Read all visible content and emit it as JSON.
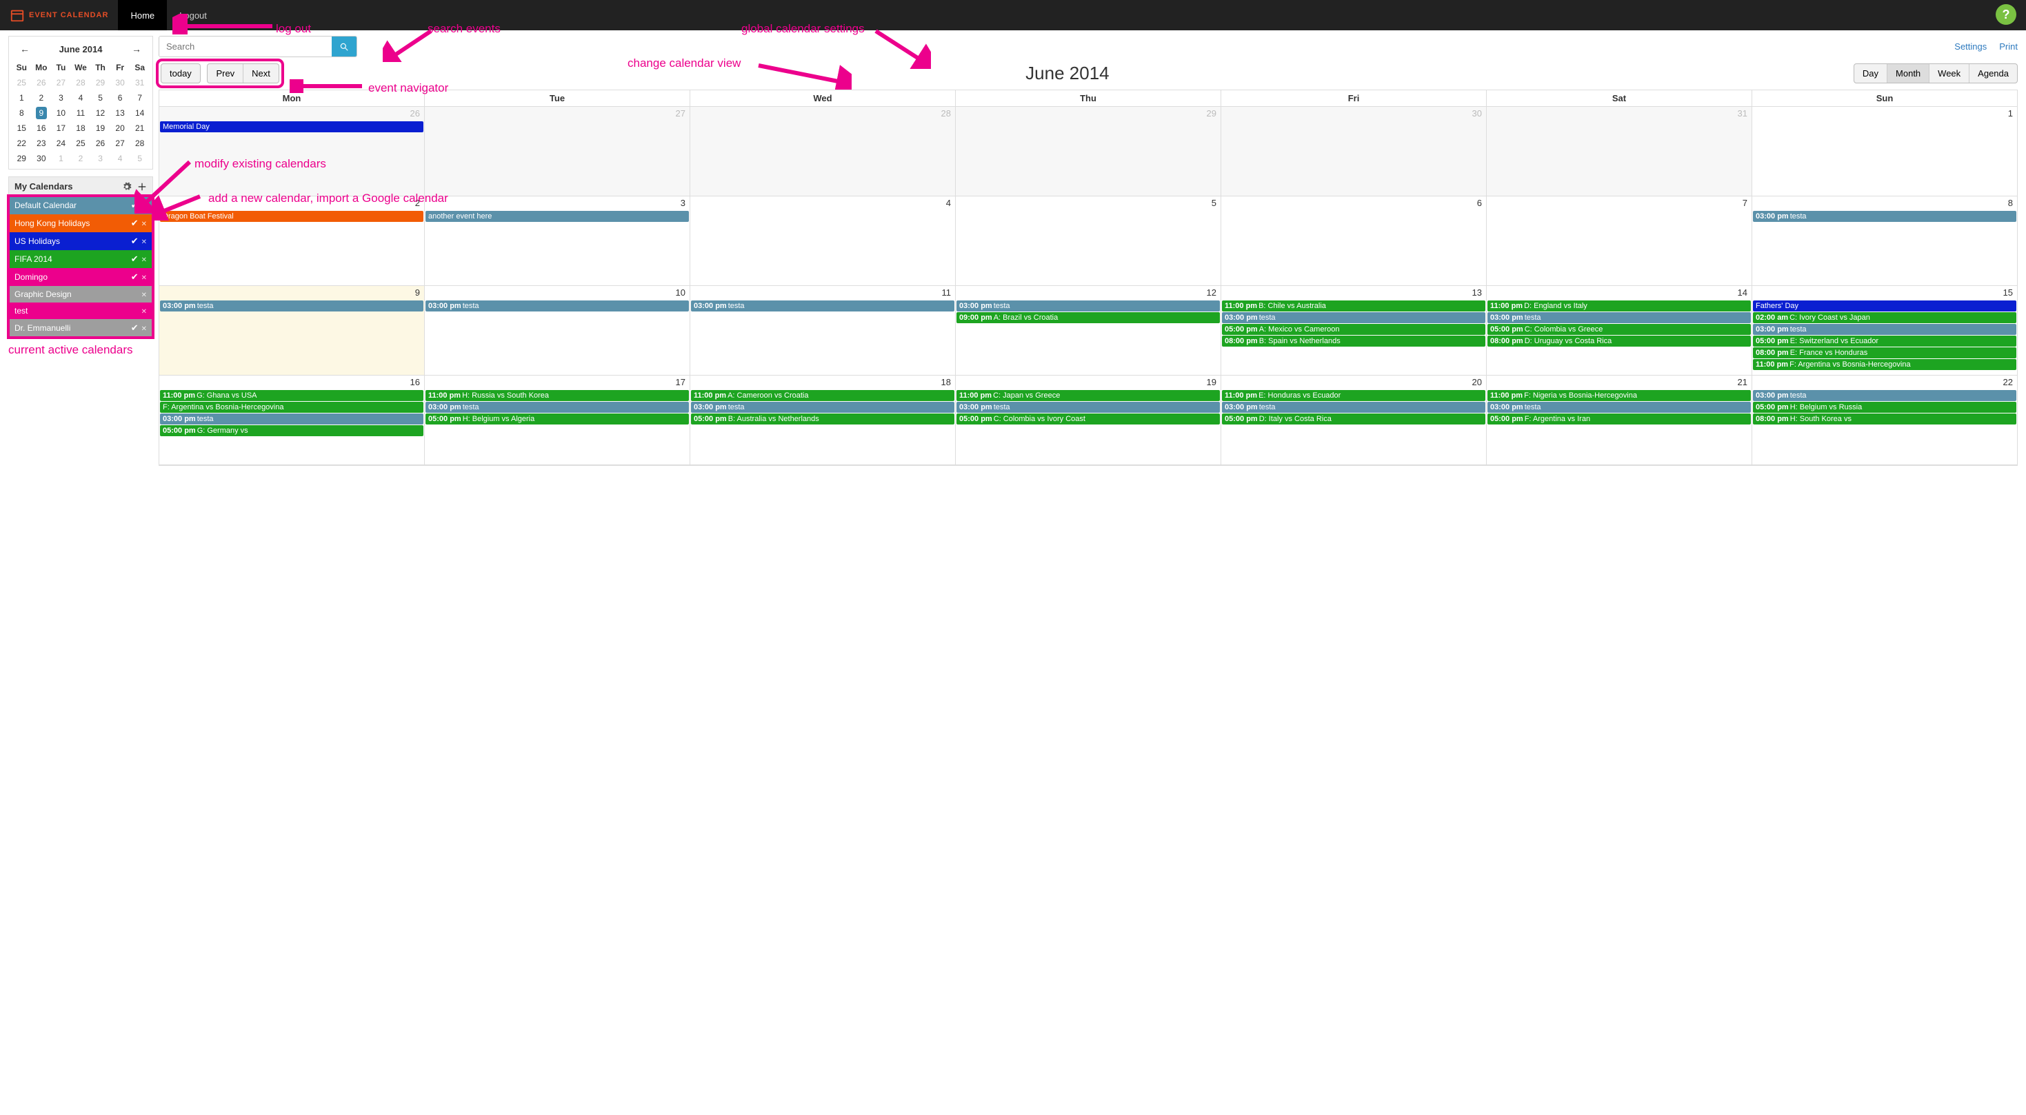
{
  "nav": {
    "logo": "EVENT CALENDAR",
    "home": "Home",
    "logout": "Logout"
  },
  "links": {
    "settings": "Settings",
    "print": "Print"
  },
  "search": {
    "placeholder": "Search"
  },
  "navbtn": {
    "today": "today",
    "prev": "Prev",
    "next": "Next"
  },
  "title": "June 2014",
  "views": {
    "day": "Day",
    "month": "Month",
    "week": "Week",
    "agenda": "Agenda"
  },
  "dow": [
    "Mon",
    "Tue",
    "Wed",
    "Thu",
    "Fri",
    "Sat",
    "Sun"
  ],
  "mini": {
    "title": "June 2014",
    "dow": [
      "Su",
      "Mo",
      "Tu",
      "We",
      "Th",
      "Fr",
      "Sa"
    ],
    "rows": [
      [
        {
          "n": 25,
          "dim": true
        },
        {
          "n": 26,
          "dim": true
        },
        {
          "n": 27,
          "dim": true
        },
        {
          "n": 28,
          "dim": true
        },
        {
          "n": 29,
          "dim": true
        },
        {
          "n": 30,
          "dim": true
        },
        {
          "n": 31,
          "dim": true
        }
      ],
      [
        {
          "n": 1
        },
        {
          "n": 2
        },
        {
          "n": 3
        },
        {
          "n": 4
        },
        {
          "n": 5
        },
        {
          "n": 6
        },
        {
          "n": 7
        }
      ],
      [
        {
          "n": 8
        },
        {
          "n": 9,
          "today": true
        },
        {
          "n": 10
        },
        {
          "n": 11
        },
        {
          "n": 12
        },
        {
          "n": 13
        },
        {
          "n": 14
        }
      ],
      [
        {
          "n": 15
        },
        {
          "n": 16
        },
        {
          "n": 17
        },
        {
          "n": 18
        },
        {
          "n": 19
        },
        {
          "n": 20
        },
        {
          "n": 21
        }
      ],
      [
        {
          "n": 22
        },
        {
          "n": 23
        },
        {
          "n": 24
        },
        {
          "n": 25
        },
        {
          "n": 26
        },
        {
          "n": 27
        },
        {
          "n": 28
        }
      ],
      [
        {
          "n": 29
        },
        {
          "n": 30
        },
        {
          "n": 1,
          "dim": true
        },
        {
          "n": 2,
          "dim": true
        },
        {
          "n": 3,
          "dim": true
        },
        {
          "n": 4,
          "dim": true
        },
        {
          "n": 5,
          "dim": true
        }
      ]
    ]
  },
  "mycalTitle": "My Calendars",
  "calendars": [
    {
      "name": "Default Calendar",
      "color": "#5b91aa",
      "checked": true
    },
    {
      "name": "Hong Kong Holidays",
      "color": "#f25c05",
      "checked": true
    },
    {
      "name": "US Holidays",
      "color": "#0a1fd1",
      "checked": true
    },
    {
      "name": "FIFA 2014",
      "color": "#1da421",
      "checked": true
    },
    {
      "name": "Domingo",
      "color": "#ec008c",
      "checked": true
    },
    {
      "name": "Graphic Design",
      "color": "#9e9e9e",
      "checked": false
    },
    {
      "name": "test",
      "color": "#ec008c",
      "checked": false
    },
    {
      "name": "Dr. Emmanuelli",
      "color": "#9e9e9e",
      "checked": true
    }
  ],
  "colors": {
    "blue": "#0a1fd1",
    "orange": "#f25c05",
    "teal": "#5b91aa",
    "green": "#1da421"
  },
  "weeks": [
    [
      {
        "n": 26,
        "other": true,
        "ev": [
          {
            "c": "blue",
            "txt": "Memorial Day"
          }
        ]
      },
      {
        "n": 27,
        "other": true
      },
      {
        "n": 28,
        "other": true
      },
      {
        "n": 29,
        "other": true
      },
      {
        "n": 30,
        "other": true
      },
      {
        "n": 31,
        "other": true
      },
      {
        "n": 1
      }
    ],
    [
      {
        "n": 2,
        "ev": [
          {
            "c": "orange",
            "txt": "Dragon Boat Festival"
          }
        ]
      },
      {
        "n": 3,
        "ev": [
          {
            "c": "teal",
            "txt": "another event here"
          }
        ]
      },
      {
        "n": 4
      },
      {
        "n": 5
      },
      {
        "n": 6
      },
      {
        "n": 7
      },
      {
        "n": 8,
        "ev": [
          {
            "c": "teal",
            "t": "03:00 pm",
            "txt": "testa"
          }
        ]
      }
    ],
    [
      {
        "n": 9,
        "today": true,
        "ev": [
          {
            "c": "teal",
            "t": "03:00 pm",
            "txt": "testa"
          }
        ]
      },
      {
        "n": 10,
        "ev": [
          {
            "c": "teal",
            "t": "03:00 pm",
            "txt": "testa"
          }
        ]
      },
      {
        "n": 11,
        "ev": [
          {
            "c": "teal",
            "t": "03:00 pm",
            "txt": "testa"
          }
        ]
      },
      {
        "n": 12,
        "ev": [
          {
            "c": "teal",
            "t": "03:00 pm",
            "txt": "testa"
          },
          {
            "c": "green",
            "t": "09:00 pm",
            "txt": "A: Brazil vs Croatia"
          }
        ]
      },
      {
        "n": 13,
        "ev": [
          {
            "c": "green",
            "t": "11:00 pm",
            "txt": "B: Chile vs Australia"
          },
          {
            "c": "teal",
            "t": "03:00 pm",
            "txt": "testa"
          },
          {
            "c": "green",
            "t": "05:00 pm",
            "txt": "A: Mexico vs Cameroon"
          },
          {
            "c": "green",
            "t": "08:00 pm",
            "txt": "B: Spain vs Netherlands"
          }
        ]
      },
      {
        "n": 14,
        "ev": [
          {
            "c": "green",
            "t": "11:00 pm",
            "txt": "D: England vs Italy"
          },
          {
            "c": "teal",
            "t": "03:00 pm",
            "txt": "testa"
          },
          {
            "c": "green",
            "t": "05:00 pm",
            "txt": "C: Colombia vs Greece"
          },
          {
            "c": "green",
            "t": "08:00 pm",
            "txt": "D: Uruguay vs Costa Rica"
          }
        ]
      },
      {
        "n": 15,
        "ev": [
          {
            "c": "blue",
            "txt": "Fathers' Day"
          },
          {
            "c": "green",
            "t": "02:00 am",
            "txt": "C: Ivory Coast vs Japan"
          },
          {
            "c": "teal",
            "t": "03:00 pm",
            "txt": "testa"
          },
          {
            "c": "green",
            "t": "05:00 pm",
            "txt": "E: Switzerland vs Ecuador"
          },
          {
            "c": "green",
            "t": "08:00 pm",
            "txt": "E: France vs Honduras"
          },
          {
            "c": "green",
            "t": "11:00 pm",
            "txt": "F: Argentina vs Bosnia-Hercegovina"
          }
        ]
      }
    ],
    [
      {
        "n": 16,
        "ev": [
          {
            "c": "green",
            "t": "11:00 pm",
            "txt": "G: Ghana vs USA"
          },
          {
            "c": "green",
            "txt": "F: Argentina vs Bosnia-Hercegovina"
          },
          {
            "c": "teal",
            "t": "03:00 pm",
            "txt": "testa"
          },
          {
            "c": "green",
            "t": "05:00 pm",
            "txt": "G: Germany vs"
          }
        ]
      },
      {
        "n": 17,
        "ev": [
          {
            "c": "green",
            "t": "11:00 pm",
            "txt": "H: Russia vs South Korea"
          },
          {
            "c": "teal",
            "t": "03:00 pm",
            "txt": "testa"
          },
          {
            "c": "green",
            "t": "05:00 pm",
            "txt": "H: Belgium vs Algeria"
          }
        ]
      },
      {
        "n": 18,
        "ev": [
          {
            "c": "green",
            "t": "11:00 pm",
            "txt": "A: Cameroon vs Croatia"
          },
          {
            "c": "teal",
            "t": "03:00 pm",
            "txt": "testa"
          },
          {
            "c": "green",
            "t": "05:00 pm",
            "txt": "B: Australia vs Netherlands"
          }
        ]
      },
      {
        "n": 19,
        "ev": [
          {
            "c": "green",
            "t": "11:00 pm",
            "txt": "C: Japan vs Greece"
          },
          {
            "c": "teal",
            "t": "03:00 pm",
            "txt": "testa"
          },
          {
            "c": "green",
            "t": "05:00 pm",
            "txt": "C: Colombia vs Ivory Coast"
          }
        ]
      },
      {
        "n": 20,
        "ev": [
          {
            "c": "green",
            "t": "11:00 pm",
            "txt": "E: Honduras vs Ecuador"
          },
          {
            "c": "teal",
            "t": "03:00 pm",
            "txt": "testa"
          },
          {
            "c": "green",
            "t": "05:00 pm",
            "txt": "D: Italy vs Costa Rica"
          }
        ]
      },
      {
        "n": 21,
        "ev": [
          {
            "c": "green",
            "t": "11:00 pm",
            "txt": "F: Nigeria vs Bosnia-Hercegovina"
          },
          {
            "c": "teal",
            "t": "03:00 pm",
            "txt": "testa"
          },
          {
            "c": "green",
            "t": "05:00 pm",
            "txt": "F: Argentina vs Iran"
          }
        ]
      },
      {
        "n": 22,
        "ev": [
          {
            "c": "teal",
            "t": "03:00 pm",
            "txt": "testa"
          },
          {
            "c": "green",
            "t": "05:00 pm",
            "txt": "H: Belgium vs Russia"
          },
          {
            "c": "green",
            "t": "08:00 pm",
            "txt": "H: South Korea vs"
          }
        ]
      }
    ]
  ],
  "annotations": {
    "logout": "log out",
    "search": "search events",
    "globalsettings": "global calendar settings",
    "changeview": "change calendar view",
    "eventnav": "event navigator",
    "modify": "modify existing calendars",
    "addnew": "add a new calendar, import a Google calendar",
    "active": "current active calendars"
  }
}
